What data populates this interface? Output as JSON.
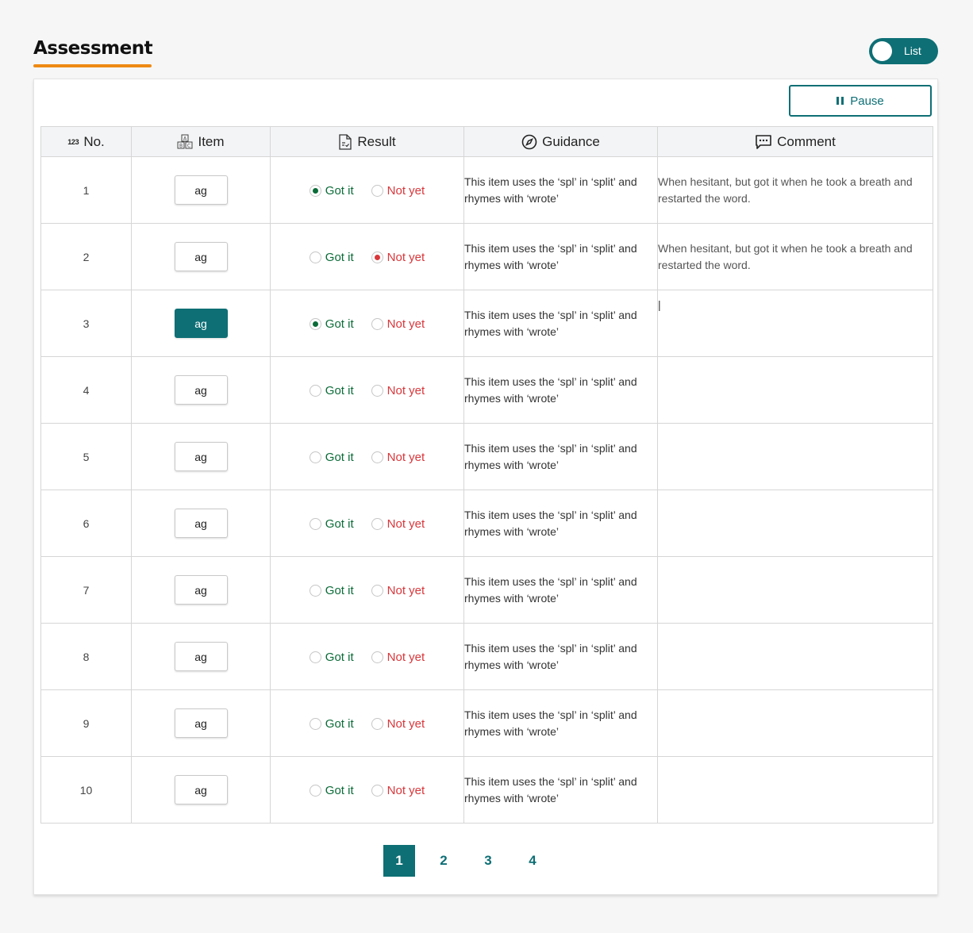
{
  "header": {
    "title": "Assessment"
  },
  "view_toggle": {
    "label": "List"
  },
  "toolbar": {
    "pause_label": "Pause"
  },
  "table": {
    "columns": {
      "no": "No.",
      "no_icon_text": "123",
      "item": "Item",
      "item_icon_text": [
        "A",
        "B",
        "C"
      ],
      "result": "Result",
      "guidance": "Guidance",
      "comment": "Comment"
    },
    "result_options": {
      "got": "Got it",
      "not": "Not yet"
    },
    "rows": [
      {
        "no": "1",
        "item": "ag",
        "active": false,
        "result": "got",
        "guidance": "This item uses the ‘spl’ in ‘split’ and rhymes with ‘wrote’",
        "comment": "When hesitant, but got it when he took a breath and restarted the word."
      },
      {
        "no": "2",
        "item": "ag",
        "active": false,
        "result": "not",
        "guidance": "This item uses the ‘spl’ in ‘split’ and rhymes with ‘wrote’",
        "comment": "When hesitant, but got it when he took a breath and restarted the word."
      },
      {
        "no": "3",
        "item": "ag",
        "active": true,
        "result": "got",
        "guidance": "This item uses the ‘spl’ in ‘split’ and rhymes with ‘wrote’",
        "comment": "",
        "editing": true
      },
      {
        "no": "4",
        "item": "ag",
        "active": false,
        "result": "",
        "guidance": "This item uses the ‘spl’ in ‘split’ and rhymes with ‘wrote’",
        "comment": ""
      },
      {
        "no": "5",
        "item": "ag",
        "active": false,
        "result": "",
        "guidance": "This item uses the ‘spl’ in ‘split’ and rhymes with ‘wrote’",
        "comment": ""
      },
      {
        "no": "6",
        "item": "ag",
        "active": false,
        "result": "",
        "guidance": "This item uses the ‘spl’ in ‘split’ and rhymes with ‘wrote’",
        "comment": ""
      },
      {
        "no": "7",
        "item": "ag",
        "active": false,
        "result": "",
        "guidance": "This item uses the ‘spl’ in ‘split’ and rhymes with ‘wrote’",
        "comment": ""
      },
      {
        "no": "8",
        "item": "ag",
        "active": false,
        "result": "",
        "guidance": "This item uses the ‘spl’ in ‘split’ and rhymes with ‘wrote’",
        "comment": ""
      },
      {
        "no": "9",
        "item": "ag",
        "active": false,
        "result": "",
        "guidance": "This item uses the ‘spl’ in ‘split’ and rhymes with ‘wrote’",
        "comment": ""
      },
      {
        "no": "10",
        "item": "ag",
        "active": false,
        "result": "",
        "guidance": "This item uses the ‘spl’ in ‘split’ and rhymes with ‘wrote’",
        "comment": ""
      }
    ]
  },
  "pagination": {
    "pages": [
      "1",
      "2",
      "3",
      "4"
    ],
    "current": "1"
  },
  "colors": {
    "accent": "#0e6f75",
    "title_underline": "#ee8a14",
    "got": "#0b6b38",
    "not": "#d9373b"
  },
  "icons": {
    "no": "number-123-icon",
    "item": "abc-blocks-icon",
    "result": "document-check-icon",
    "guidance": "compass-icon",
    "comment": "speech-bubble-icon",
    "pause": "pause-icon"
  }
}
